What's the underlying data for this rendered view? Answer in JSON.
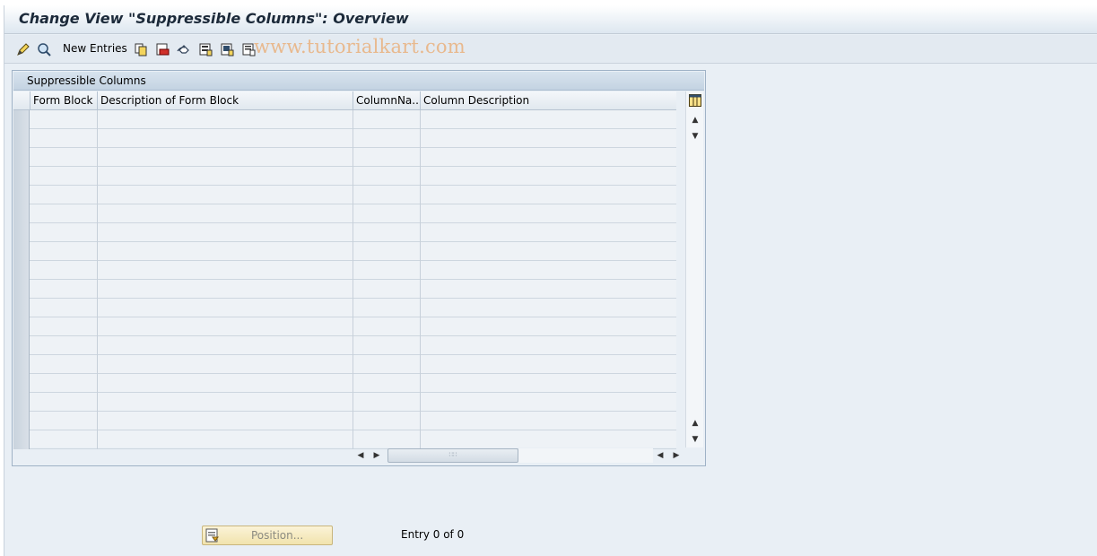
{
  "window": {
    "title": "Change View \"Suppressible Columns\": Overview"
  },
  "toolbar": {
    "new_entries_label": "New Entries",
    "watermark": "www.tutorialkart.com",
    "icons": [
      "display-change-icon",
      "find-icon",
      "copy-as-icon",
      "delete-icon",
      "undo-change-icon",
      "select-all-icon",
      "select-block-icon",
      "deselect-all-icon"
    ]
  },
  "table": {
    "title": "Suppressible Columns",
    "columns": [
      "Form Block",
      "Description of Form Block",
      "ColumnNa...",
      "Column Description"
    ],
    "rows": [],
    "visible_empty_rows": 18,
    "settings_icon": "table-settings-icon"
  },
  "footer": {
    "position_label": "Position...",
    "entry_status": "Entry 0 of 0"
  }
}
